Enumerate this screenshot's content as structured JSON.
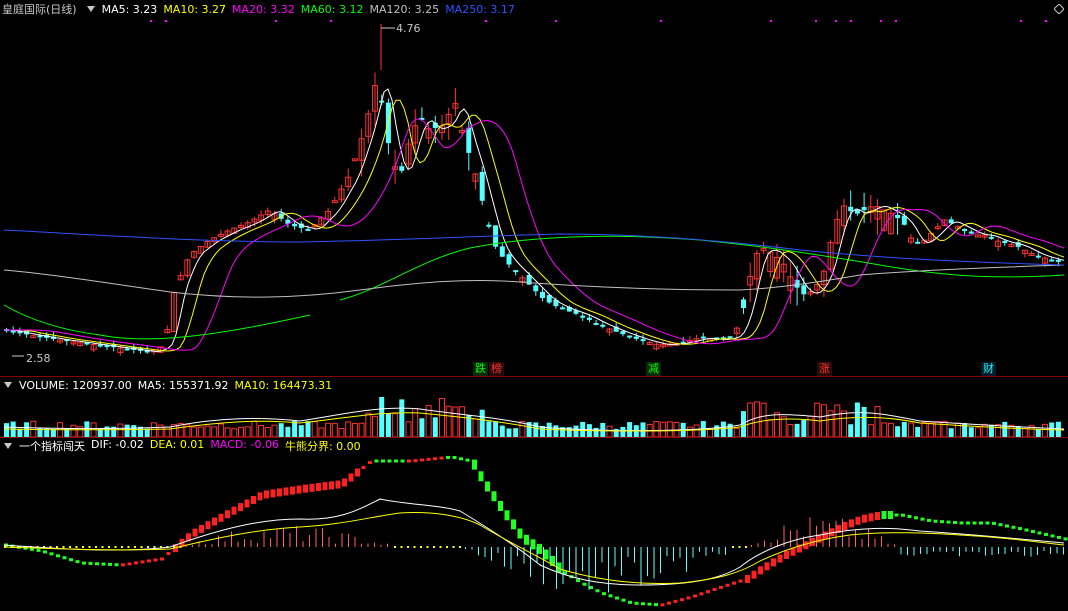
{
  "main_header": {
    "stock_title": "皇庭国际(日线)",
    "ma": [
      {
        "label": "MA5: 3.23",
        "color": "#ffffff"
      },
      {
        "label": "MA10: 3.27",
        "color": "#ffff00"
      },
      {
        "label": "MA20: 3.32",
        "color": "#ff00ff"
      },
      {
        "label": "MA60: 3.12",
        "color": "#00ff00"
      },
      {
        "label": "MA120: 3.25",
        "color": "#c0c0c0"
      },
      {
        "label": "MA250: 3.17",
        "color": "#2f52ff"
      }
    ]
  },
  "price": {
    "high_label": "4.76",
    "low_label": "2.58",
    "tags": [
      {
        "text": "跌",
        "color": "#00ff00",
        "bg": "#0a2a0a"
      },
      {
        "text": "榜",
        "color": "#ff3333",
        "bg": "#2a0a0a"
      },
      {
        "text": "减",
        "color": "#00ff00",
        "bg": "#0a2a0a"
      },
      {
        "text": "涨",
        "color": "#ff3333",
        "bg": "#2a0a0a"
      },
      {
        "text": "财",
        "color": "#00ffff",
        "bg": "#0a1a2a"
      }
    ]
  },
  "volume_header": {
    "items": [
      {
        "label": "VOLUME: 120937.00",
        "color": "#ffffff"
      },
      {
        "label": "MA5: 155371.92",
        "color": "#ffffff"
      },
      {
        "label": "MA10: 164473.31",
        "color": "#ffff00"
      }
    ]
  },
  "macd_header": {
    "indicator_name": "一个指标闯天",
    "items": [
      {
        "label": "DIF: -0.02",
        "color": "#ffffff"
      },
      {
        "label": "DEA: 0.01",
        "color": "#ffff00"
      },
      {
        "label": "MACD: -0.06",
        "color": "#ff00ff"
      },
      {
        "label": "牛熊分界: 0.00",
        "color": "#ffff00"
      }
    ]
  },
  "colors": {
    "up": "#ff3232",
    "down": "#54ffff",
    "grid": "#8b0000"
  }
}
